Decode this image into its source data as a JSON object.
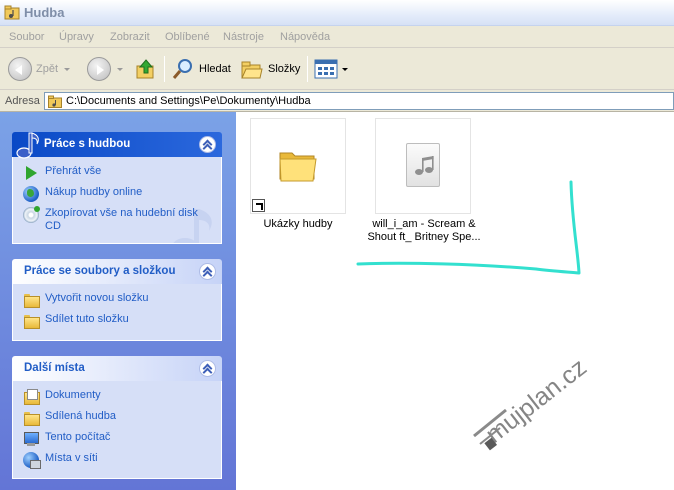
{
  "window": {
    "title": "Hudba"
  },
  "menu": [
    "Soubor",
    "Úpravy",
    "Zobrazit",
    "Oblíbené",
    "Nástroje",
    "Nápověda"
  ],
  "toolbar": {
    "back": "Zpět",
    "search": "Hledat",
    "folders": "Složky"
  },
  "address": {
    "label": "Adresa",
    "path": "C:\\Documents and Settings\\Pe\\Dokumenty\\Hudba"
  },
  "taskpane": {
    "music": {
      "title": "Práce s hudbou",
      "items": [
        "Přehrát vše",
        "Nákup hudby online",
        "Zkopírovat vše na hudební disk CD"
      ]
    },
    "files": {
      "title": "Práce se soubory a složkou",
      "items": [
        "Vytvořit novou složku",
        "Sdílet tuto složku"
      ]
    },
    "places": {
      "title": "Další místa",
      "items": [
        "Dokumenty",
        "Sdílená hudba",
        "Tento počítač",
        "Místa v síti"
      ]
    }
  },
  "files": [
    {
      "name": "Ukázky hudby",
      "type": "folder-shortcut",
      "icon": "folder-icon"
    },
    {
      "name": "will_i_am - Scream & Shout ft_ Britney Spe...",
      "type": "audio",
      "icon": "music-file-icon"
    }
  ],
  "watermark": "mujplan.cz",
  "annotation": {
    "color": "#33e0cf"
  },
  "colors": {
    "taskpane_top": "#7ba2e7",
    "taskpane_bottom": "#6375d6",
    "link": "#215dc6",
    "special_header": "#0a49c6"
  }
}
